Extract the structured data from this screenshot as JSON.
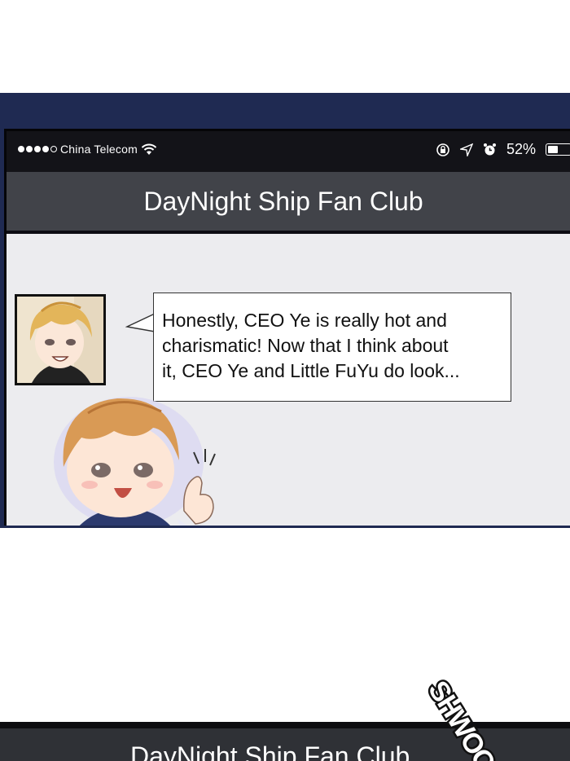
{
  "status_bar": {
    "carrier": "China Telecom",
    "battery_percent": "52%",
    "battery_level": 0.52,
    "icons": [
      "signal-dots-icon",
      "wifi-icon",
      "rotation-lock-icon",
      "location-arrow-icon",
      "alarm-clock-icon",
      "battery-icon"
    ]
  },
  "chat": {
    "title": "DayNight Ship Fan Club",
    "message_lines": [
      "Honestly, CEO Ye is really hot and",
      "charismatic! Now that I think about",
      "it, CEO Ye and Little FuYu do look..."
    ]
  },
  "panel2": {
    "title": "DayNight Ship Fan Club"
  },
  "sfx_text": "SHWOO",
  "colors": {
    "frame": "#1f2a52",
    "title_bar": "#414349",
    "chat_bg": "#ececef",
    "status_bar": "#131318"
  }
}
